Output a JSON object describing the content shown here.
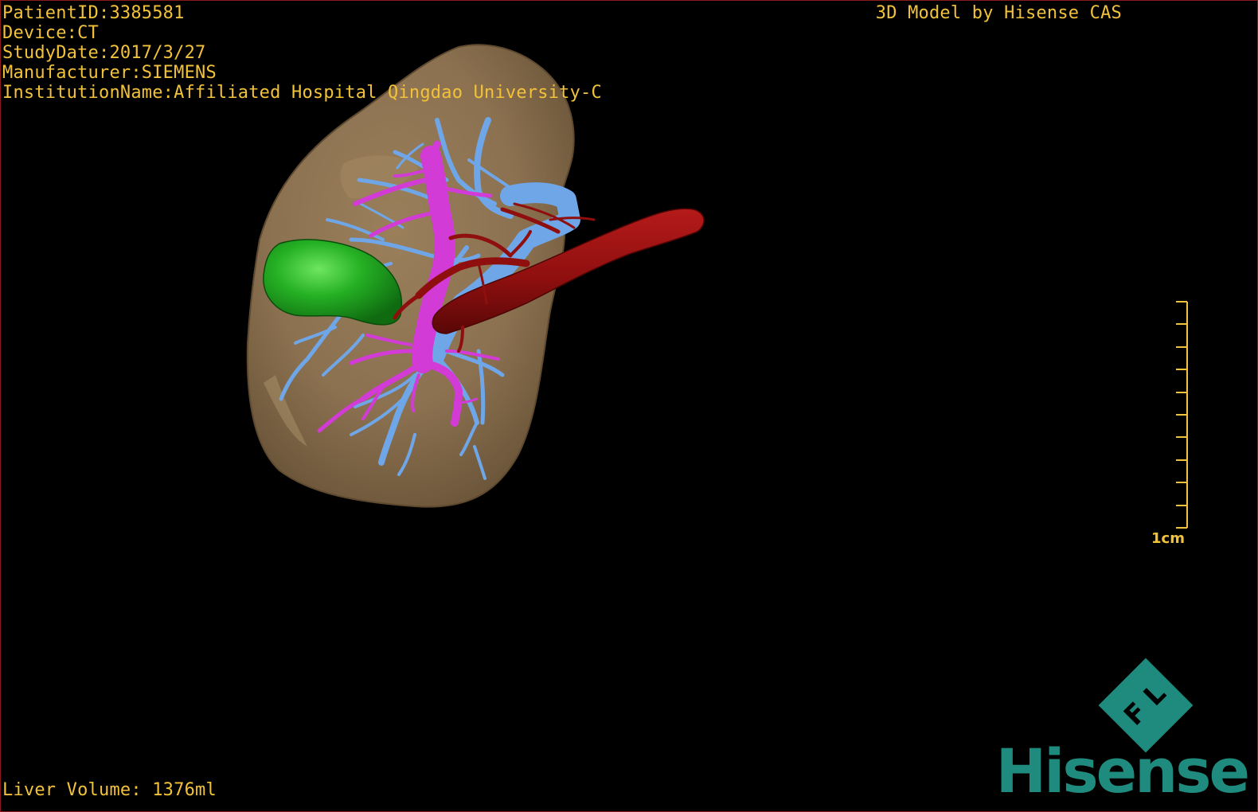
{
  "overlay": {
    "patient_id": "PatientID:3385581",
    "device": "Device:CT",
    "study_date": "StudyDate:2017/3/27",
    "manufacturer": "Manufacturer:SIEMENS",
    "institution": "InstitutionName:Affiliated Hospital Qingdao University-C",
    "credit": "3D Model by Hisense CAS",
    "liver_volume": "Liver Volume: 1376ml"
  },
  "scale": {
    "label": "1cm"
  },
  "logo": {
    "badge_text": "F L",
    "wordmark": "Hisense"
  },
  "colors": {
    "overlay_text": "#f2c23a",
    "liver": "#8b7150",
    "gallbladder": "#21a31f",
    "hepatic_vein": "#6fa6e8",
    "portal_vein": "#d23bd6",
    "artery": "#8f0f0f",
    "logo": "#1f8b7e",
    "border": "#8b1a1a"
  }
}
